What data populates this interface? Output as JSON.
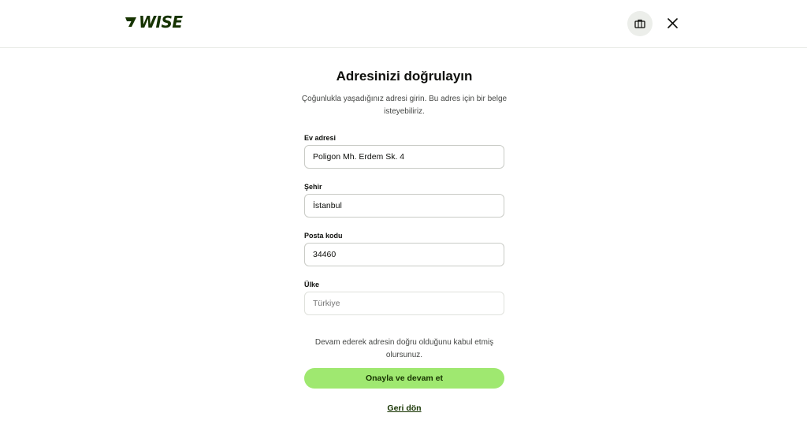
{
  "header": {
    "logo_text": "WISE",
    "help_icon": "briefcase-icon",
    "close_icon": "close-icon"
  },
  "form": {
    "title": "Adresinizi doğrulayın",
    "subtitle": "Çoğunlukla yaşadığınız adresi girin. Bu adres için bir belge isteyebiliriz.",
    "fields": {
      "address": {
        "label": "Ev adresi",
        "value": "Poligon Mh. Erdem Sk. 4"
      },
      "city": {
        "label": "Şehir",
        "value": "İstanbul"
      },
      "postal": {
        "label": "Posta kodu",
        "value": "34460"
      },
      "country": {
        "label": "Ülke",
        "placeholder": "Türkiye"
      }
    },
    "consent": "Devam ederek adresin doğru olduğunu kabul etmiş olursunuz.",
    "primary_button": "Onayla ve devam et",
    "back_link": "Geri dön"
  },
  "colors": {
    "brand": "#163300",
    "accent": "#9fe870"
  }
}
